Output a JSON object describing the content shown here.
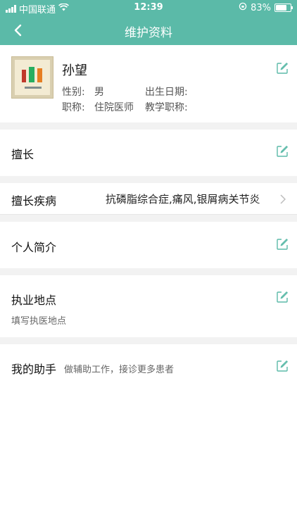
{
  "status_bar": {
    "carrier": "中国联通",
    "time": "12:39",
    "battery": "83%",
    "battery_level": 0.83
  },
  "nav": {
    "title": "维护资料",
    "back_icon": "chevron-left-icon"
  },
  "profile": {
    "name": "孙望",
    "gender_label": "性别:",
    "gender_value": "男",
    "birth_label": "出生日期:",
    "birth_value": "",
    "title_label": "职称:",
    "title_value": "住院医师",
    "teaching_label": "教学职称:",
    "teaching_value": ""
  },
  "specialty": {
    "label": "擅长"
  },
  "disease": {
    "label": "擅长疾病",
    "value": "抗磷脂综合症,痛风,银屑病关节炎"
  },
  "bio": {
    "label": "个人简介"
  },
  "practice": {
    "label": "执业地点",
    "placeholder": "填写执医地点"
  },
  "assistant": {
    "label": "我的助手",
    "desc": "做辅助工作，接诊更多患者"
  },
  "colors": {
    "header": "#5bbaa8",
    "accent_icon": "#5bbaa8",
    "section_gap": "#f2f2f2"
  }
}
